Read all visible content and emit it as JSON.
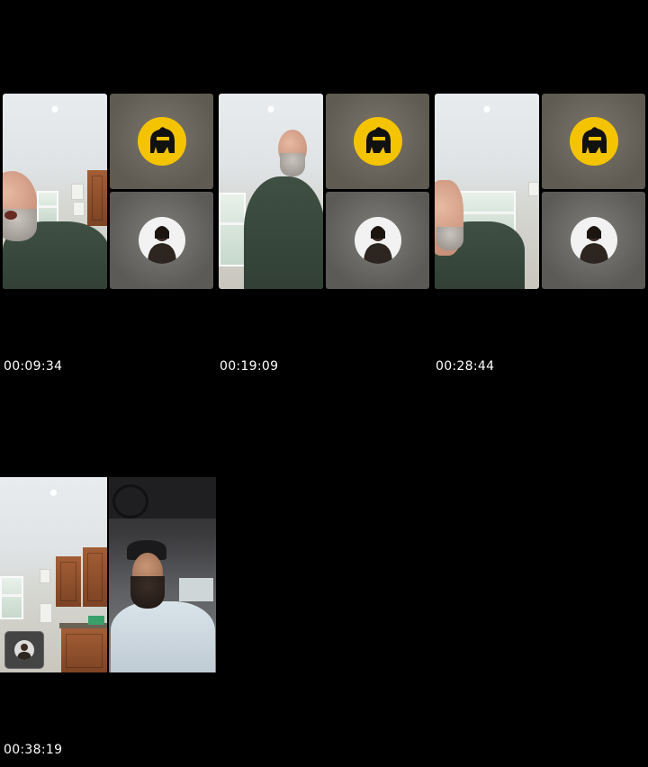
{
  "timestamps": [
    "00:09:34",
    "00:19:09",
    "00:28:44",
    "00:38:19"
  ],
  "icons": {
    "gorilla_logo": "gorilla-logo-icon",
    "contact_avatar": "contact-avatar-icon",
    "self_view": "self-view-icon"
  },
  "colors": {
    "background": "#000000",
    "logo_yellow": "#f5c400",
    "tile_gray": "#6b685f",
    "timestamp_text": "#ffffff"
  }
}
